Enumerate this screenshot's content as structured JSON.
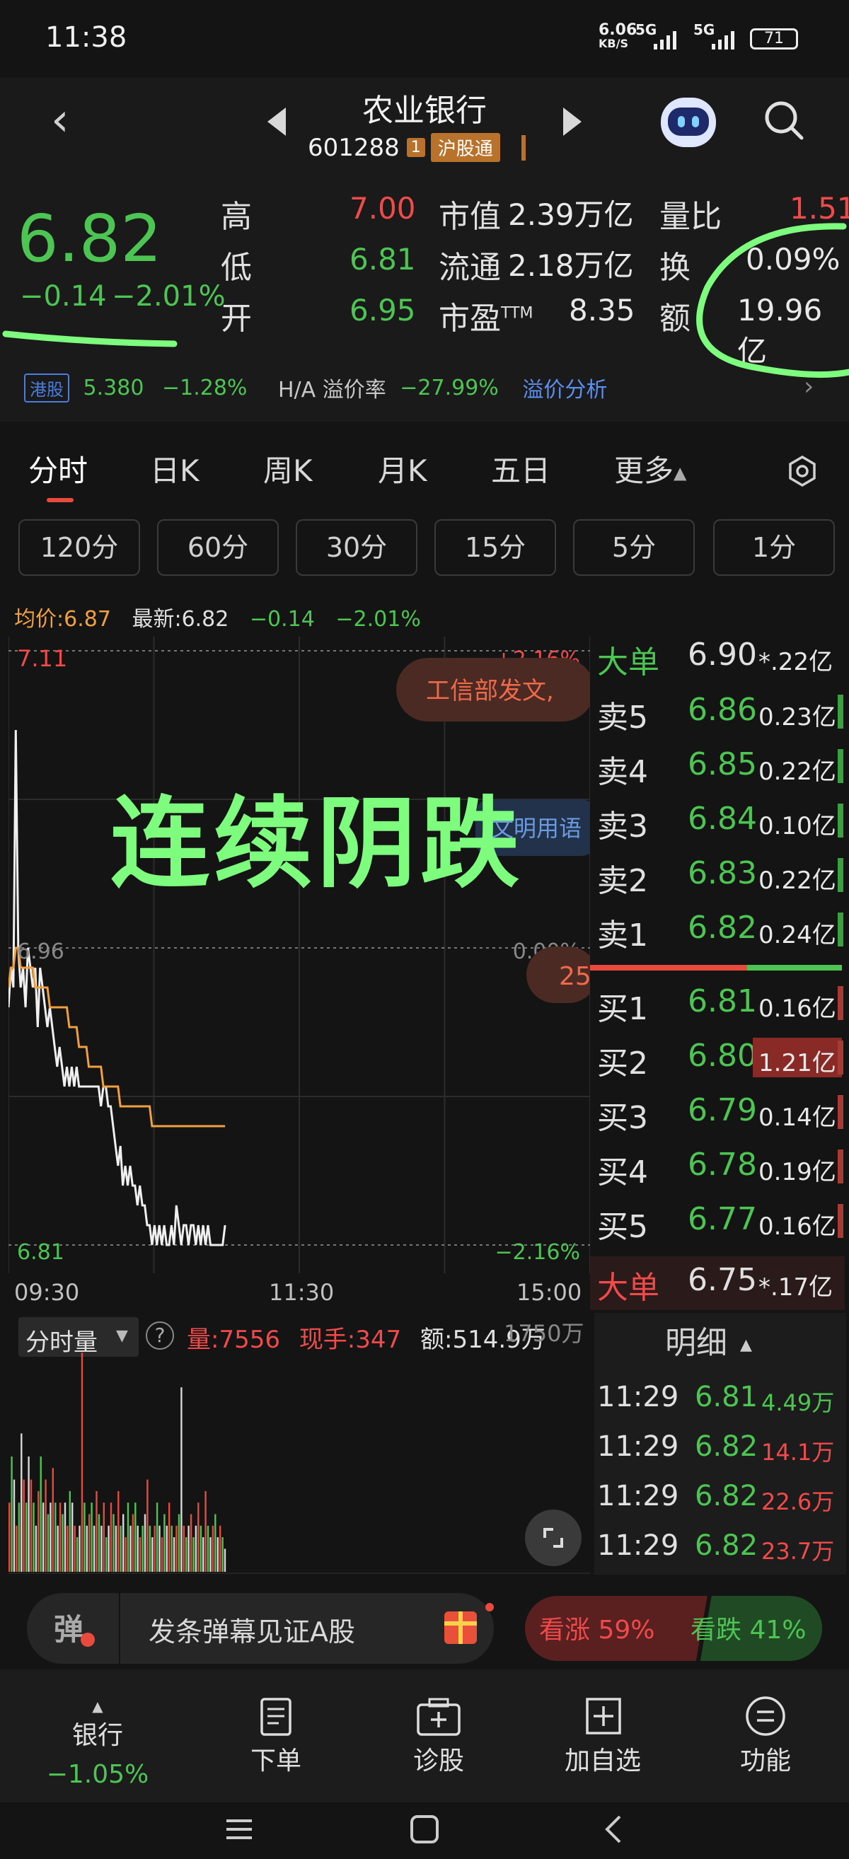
{
  "status_bar": {
    "time": "11:38",
    "net_speed_value": "6.06",
    "net_speed_unit": "KB/S",
    "sig1": "5G",
    "sig2": "5G",
    "battery": "71"
  },
  "header": {
    "title": "农业银行",
    "code": "601288",
    "tag_small": "1",
    "tag_market": "沪股通"
  },
  "quote": {
    "price": "6.82",
    "change": "−0.14",
    "change_pct": "−2.01%",
    "rows": [
      {
        "label": "高",
        "value": "7.00",
        "label2": "市值",
        "value2": "2.39万亿",
        "label3": "量比",
        "value3": "1.51"
      },
      {
        "label": "低",
        "value": "6.81",
        "label2": "流通",
        "value2": "2.18万亿",
        "label3": "换",
        "value3": "0.09%"
      },
      {
        "label": "开",
        "value": "6.95",
        "label2": "市盈",
        "label2_sup": "TTM",
        "value2": "8.35",
        "label3": "额",
        "value3": "19.96亿"
      }
    ],
    "hk": {
      "badge": "港股",
      "price": "5.380",
      "pct": "−1.28%",
      "premium_label": "H/A 溢价率",
      "premium": "−27.99%",
      "analysis": "溢价分析"
    },
    "colors": {
      "up": "#f04a4a",
      "down": "#4cc552",
      "neutral": "#e0e0e0"
    }
  },
  "tabs": {
    "items": [
      "分时",
      "日K",
      "周K",
      "月K",
      "五日",
      "更多"
    ],
    "active": "分时"
  },
  "intervals": [
    "120分",
    "60分",
    "30分",
    "15分",
    "5分",
    "1分"
  ],
  "info_line": {
    "avg_label": "均价:",
    "avg": "6.87",
    "latest_label": "最新:",
    "latest": "6.82",
    "change": "−0.14",
    "pct": "−2.01%"
  },
  "chart_labels": {
    "top_price": "7.11",
    "top_pct": "+2.16%",
    "mid_price": "6.96",
    "mid_pct": "0.00%",
    "bottom_price": "6.81",
    "bottom_pct": "−2.16%",
    "t_start": "09:30",
    "t_mid": "11:30",
    "t_end": "15:00",
    "news_bubble": "工信部发文,",
    "news_bubble2": "文明用语",
    "badge_25": "25"
  },
  "annotation_text": "连续阴跌",
  "chart_data": {
    "type": "line",
    "title": "",
    "xlabel": "",
    "ylabel": "",
    "x_ticks": [
      "09:30",
      "11:30",
      "15:00"
    ],
    "ylim": [
      6.81,
      7.11
    ],
    "reference_price": 6.96,
    "series": [
      {
        "name": "",
        "values": [
          6.93,
          6.95,
          6.94,
          7.07,
          6.96,
          6.94,
          6.95,
          6.93,
          6.96,
          6.95,
          6.94,
          6.95,
          6.92,
          6.95,
          6.94,
          6.93,
          6.92,
          6.93,
          6.92,
          6.91,
          6.9,
          6.91,
          6.9,
          6.89,
          6.9,
          6.89,
          6.9,
          6.89,
          6.9,
          6.89,
          6.89,
          6.89,
          6.89,
          6.89,
          6.89,
          6.89,
          6.89,
          6.89,
          6.88,
          6.89,
          6.89,
          6.88,
          6.88,
          6.87,
          6.86,
          6.85,
          6.86,
          6.84,
          6.85,
          6.84,
          6.85,
          6.84,
          6.84,
          6.83,
          6.84,
          6.83,
          6.83,
          6.82,
          6.82,
          6.81,
          6.82,
          6.81,
          6.82,
          6.81,
          6.82,
          6.81,
          6.81,
          6.82,
          6.81,
          6.83,
          6.82,
          6.81,
          6.82,
          6.82,
          6.81,
          6.82,
          6.82,
          6.81,
          6.82,
          6.81,
          6.82,
          6.81,
          6.82,
          6.81,
          6.81,
          6.81,
          6.81,
          6.81,
          6.81,
          6.82
        ]
      },
      {
        "name": "均价",
        "values": [
          6.94,
          6.95,
          6.95,
          6.96,
          6.96,
          6.95,
          6.95,
          6.95,
          6.95,
          6.95,
          6.95,
          6.94,
          6.94,
          6.94,
          6.94,
          6.94,
          6.94,
          6.93,
          6.93,
          6.93,
          6.93,
          6.93,
          6.93,
          6.93,
          6.93,
          6.92,
          6.92,
          6.92,
          6.92,
          6.91,
          6.91,
          6.91,
          6.91,
          6.9,
          6.9,
          6.9,
          6.9,
          6.9,
          6.9,
          6.89,
          6.89,
          6.89,
          6.89,
          6.89,
          6.89,
          6.89,
          6.88,
          6.88,
          6.88,
          6.88,
          6.88,
          6.88,
          6.88,
          6.88,
          6.88,
          6.88,
          6.88,
          6.88,
          6.88,
          6.87,
          6.87,
          6.87,
          6.87,
          6.87,
          6.87,
          6.87,
          6.87,
          6.87,
          6.87,
          6.87,
          6.87,
          6.87,
          6.87,
          6.87,
          6.87,
          6.87,
          6.87,
          6.87,
          6.87,
          6.87,
          6.87,
          6.87,
          6.87,
          6.87,
          6.87,
          6.87,
          6.87,
          6.87,
          6.87,
          6.87
        ]
      }
    ],
    "volume": {
      "values": [
        0.3,
        0.5,
        0.4,
        0.2,
        0.3,
        0.6,
        0.4,
        0.3,
        0.5,
        0.4,
        0.3,
        0.2,
        0.35,
        0.5,
        0.3,
        0.4,
        0.25,
        0.3,
        0.45,
        0.3,
        0.2,
        0.3,
        0.25,
        0.3,
        0.2,
        0.35,
        0.3,
        0.2,
        0.15,
        0.2,
        0.95,
        0.3,
        0.2,
        0.25,
        0.3,
        0.2,
        0.35,
        0.25,
        0.2,
        0.3,
        0.15,
        0.2,
        0.3,
        0.25,
        0.2,
        0.35,
        0.2,
        0.25,
        0.15,
        0.3,
        0.2,
        0.25,
        0.3,
        0.2,
        0.15,
        0.2,
        0.25,
        0.4,
        0.2,
        0.15,
        0.2,
        0.3,
        0.2,
        0.15,
        0.25,
        0.2,
        0.3,
        0.2,
        0.15,
        0.2,
        0.25,
        0.8,
        0.2,
        0.15,
        0.2,
        0.25,
        0.15,
        0.2,
        0.3,
        0.2,
        0.15,
        0.35,
        0.2,
        0.15,
        0.2,
        0.25,
        0.15,
        0.2,
        0.15,
        0.1
      ],
      "colors": [
        "red",
        "green",
        "white"
      ]
    }
  },
  "order_book": {
    "big_sell": {
      "label": "大单",
      "price": "6.90",
      "vol": "*.22亿"
    },
    "asks": [
      {
        "label": "卖5",
        "price": "6.86",
        "vol": "0.23亿"
      },
      {
        "label": "卖4",
        "price": "6.85",
        "vol": "0.22亿"
      },
      {
        "label": "卖3",
        "price": "6.84",
        "vol": "0.10亿"
      },
      {
        "label": "卖2",
        "price": "6.83",
        "vol": "0.22亿"
      },
      {
        "label": "卖1",
        "price": "6.82",
        "vol": "0.24亿"
      }
    ],
    "bids": [
      {
        "label": "买1",
        "price": "6.81",
        "vol": "0.16亿"
      },
      {
        "label": "买2",
        "price": "6.80",
        "vol": "1.21亿"
      },
      {
        "label": "买3",
        "price": "6.79",
        "vol": "0.14亿"
      },
      {
        "label": "买4",
        "price": "6.78",
        "vol": "0.19亿"
      },
      {
        "label": "买5",
        "price": "6.77",
        "vol": "0.16亿"
      }
    ],
    "big_buy": {
      "label": "大单",
      "price": "6.75",
      "vol": "*.17亿"
    }
  },
  "volume_header": {
    "selector": "分时量",
    "help": "?",
    "vol_label": "量:",
    "vol": "7556",
    "hand_label": "现手:",
    "hand": "347",
    "amt_label": "额:",
    "amt": "514.9万",
    "scale": "1750万"
  },
  "detail": {
    "title": "明细",
    "rows": [
      {
        "time": "11:29",
        "price": "6.81",
        "amt": "4.49万"
      },
      {
        "time": "11:29",
        "price": "6.82",
        "amt": "14.1万"
      },
      {
        "time": "11:29",
        "price": "6.82",
        "amt": "22.6万"
      },
      {
        "time": "11:29",
        "price": "6.82",
        "amt": "23.7万"
      }
    ]
  },
  "danmu": {
    "icon": "弹",
    "text": "发条弹幕见证A股"
  },
  "vote": {
    "up_label": "看涨",
    "up_pct": "59%",
    "down_label": "看跌",
    "down_pct": "41%",
    "up_fraction": 0.59
  },
  "bottom_nav": {
    "sector": "银行",
    "sector_pct": "−1.05%",
    "items": [
      "下单",
      "诊股",
      "加自选",
      "功能"
    ]
  }
}
